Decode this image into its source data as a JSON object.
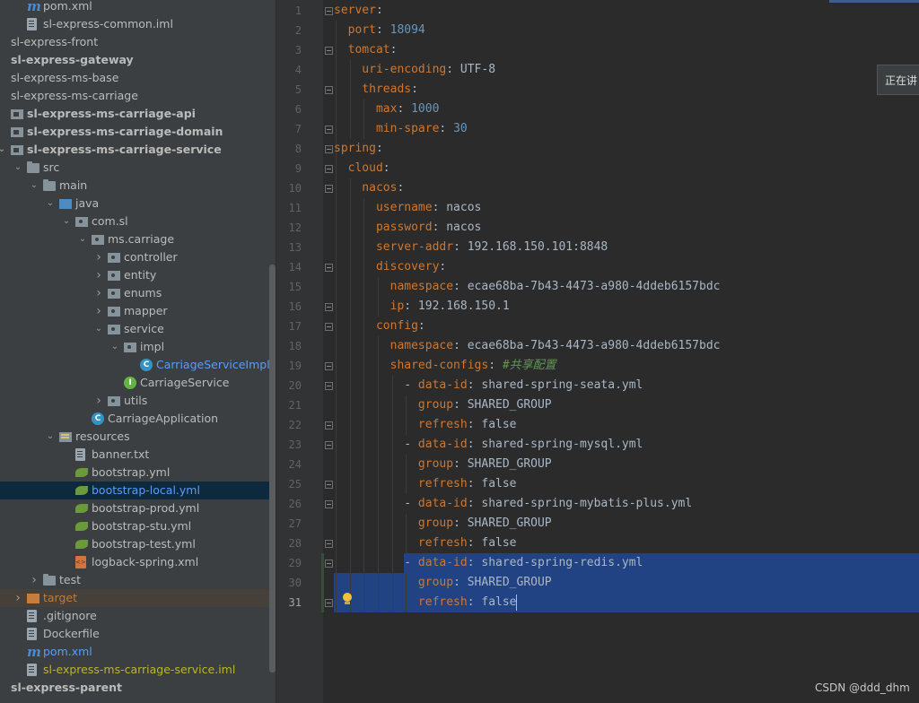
{
  "project_tree": {
    "rows": [
      {
        "label": "pom.xml",
        "icon": "maven-icon",
        "indent": 1
      },
      {
        "label": "sl-express-common.iml",
        "icon": "file-icon",
        "indent": 1
      },
      {
        "label": "sl-express-front",
        "icon": "none",
        "indent": 0
      },
      {
        "label": "sl-express-gateway",
        "icon": "none",
        "indent": 0,
        "bold": true
      },
      {
        "label": "sl-express-ms-base",
        "icon": "none",
        "indent": 0
      },
      {
        "label": "sl-express-ms-carriage",
        "icon": "none",
        "indent": 0
      },
      {
        "label": "sl-express-ms-carriage-api",
        "icon": "module-icon",
        "indent": 0,
        "bold": true
      },
      {
        "label": "sl-express-ms-carriage-domain",
        "icon": "module-icon",
        "indent": 0,
        "bold": true
      },
      {
        "label": "sl-express-ms-carriage-service",
        "icon": "module-icon",
        "indent": 0,
        "bold": true,
        "expanded": true
      },
      {
        "label": "src",
        "icon": "folder-icon",
        "indent": 1,
        "expanded": true
      },
      {
        "label": "main",
        "icon": "folder-icon",
        "indent": 2,
        "expanded": true
      },
      {
        "label": "java",
        "icon": "source-folder-icon",
        "indent": 3,
        "expanded": true
      },
      {
        "label": "com.sl",
        "icon": "package-icon",
        "indent": 4,
        "expanded": true
      },
      {
        "label": "ms.carriage",
        "icon": "package-icon",
        "indent": 5,
        "expanded": true
      },
      {
        "label": "controller",
        "icon": "package-icon",
        "indent": 6,
        "collapsed": true
      },
      {
        "label": "entity",
        "icon": "package-icon",
        "indent": 6,
        "collapsed": true
      },
      {
        "label": "enums",
        "icon": "package-icon",
        "indent": 6,
        "collapsed": true
      },
      {
        "label": "mapper",
        "icon": "package-icon",
        "indent": 6,
        "collapsed": true
      },
      {
        "label": "service",
        "icon": "package-icon",
        "indent": 6,
        "expanded": true
      },
      {
        "label": "impl",
        "icon": "package-icon",
        "indent": 7,
        "expanded": true
      },
      {
        "label": "CarriageServiceImpl",
        "icon": "class-icon",
        "indent": 8,
        "color": "blue"
      },
      {
        "label": "CarriageService",
        "icon": "interface-icon",
        "indent": 7
      },
      {
        "label": "utils",
        "icon": "package-icon",
        "indent": 6,
        "collapsed": true
      },
      {
        "label": "CarriageApplication",
        "icon": "spring-class-icon",
        "indent": 5
      },
      {
        "label": "resources",
        "icon": "resources-folder-icon",
        "indent": 3,
        "expanded": true
      },
      {
        "label": "banner.txt",
        "icon": "text-file-icon",
        "indent": 4
      },
      {
        "label": "bootstrap.yml",
        "icon": "yaml-icon",
        "indent": 4
      },
      {
        "label": "bootstrap-local.yml",
        "icon": "yaml-icon",
        "indent": 4,
        "selected": true,
        "color": "blue"
      },
      {
        "label": "bootstrap-prod.yml",
        "icon": "yaml-icon",
        "indent": 4
      },
      {
        "label": "bootstrap-stu.yml",
        "icon": "yaml-icon",
        "indent": 4
      },
      {
        "label": "bootstrap-test.yml",
        "icon": "yaml-icon",
        "indent": 4
      },
      {
        "label": "logback-spring.xml",
        "icon": "xml-icon",
        "indent": 4
      },
      {
        "label": "test",
        "icon": "folder-icon",
        "indent": 2,
        "collapsed": true
      },
      {
        "label": "target",
        "icon": "target-folder-icon",
        "indent": 1,
        "collapsed": true,
        "excluded": true,
        "color": "orange"
      },
      {
        "label": ".gitignore",
        "icon": "file-icon",
        "indent": 1
      },
      {
        "label": "Dockerfile",
        "icon": "file-icon",
        "indent": 1
      },
      {
        "label": "pom.xml",
        "icon": "maven-icon",
        "indent": 1,
        "color": "blue"
      },
      {
        "label": "sl-express-ms-carriage-service.iml",
        "icon": "file-icon",
        "indent": 1,
        "color": "yellow"
      },
      {
        "label": "sl-express-parent",
        "icon": "none",
        "indent": 0,
        "bold": true
      }
    ]
  },
  "editor": {
    "current_line": 31,
    "lines": [
      [
        {
          "t": "server",
          "c": "k"
        },
        {
          "t": ":",
          "c": "v"
        }
      ],
      [
        {
          "t": "  port",
          "c": "k"
        },
        {
          "t": ": ",
          "c": "v"
        },
        {
          "t": "18094",
          "c": "n"
        }
      ],
      [
        {
          "t": "  tomcat",
          "c": "k"
        },
        {
          "t": ":",
          "c": "v"
        }
      ],
      [
        {
          "t": "    uri-encoding",
          "c": "k"
        },
        {
          "t": ": UTF-8",
          "c": "v"
        }
      ],
      [
        {
          "t": "    threads",
          "c": "k"
        },
        {
          "t": ":",
          "c": "v"
        }
      ],
      [
        {
          "t": "      max",
          "c": "k"
        },
        {
          "t": ": ",
          "c": "v"
        },
        {
          "t": "1000",
          "c": "n"
        }
      ],
      [
        {
          "t": "      min-spare",
          "c": "k"
        },
        {
          "t": ": ",
          "c": "v"
        },
        {
          "t": "30",
          "c": "n"
        }
      ],
      [
        {
          "t": "spring",
          "c": "k"
        },
        {
          "t": ":",
          "c": "v"
        }
      ],
      [
        {
          "t": "  cloud",
          "c": "k"
        },
        {
          "t": ":",
          "c": "v"
        }
      ],
      [
        {
          "t": "    nacos",
          "c": "k"
        },
        {
          "t": ":",
          "c": "v"
        }
      ],
      [
        {
          "t": "      username",
          "c": "k"
        },
        {
          "t": ": nacos",
          "c": "v"
        }
      ],
      [
        {
          "t": "      password",
          "c": "k"
        },
        {
          "t": ": nacos",
          "c": "v"
        }
      ],
      [
        {
          "t": "      server-addr",
          "c": "k"
        },
        {
          "t": ": 192.168.150.101:8848",
          "c": "v"
        }
      ],
      [
        {
          "t": "      discovery",
          "c": "k"
        },
        {
          "t": ":",
          "c": "v"
        }
      ],
      [
        {
          "t": "        namespace",
          "c": "k"
        },
        {
          "t": ": ecae68ba-7b43-4473-a980-4ddeb6157bdc",
          "c": "v"
        }
      ],
      [
        {
          "t": "        ip",
          "c": "k"
        },
        {
          "t": ": 192.168.150.1",
          "c": "v"
        }
      ],
      [
        {
          "t": "      config",
          "c": "k"
        },
        {
          "t": ":",
          "c": "v"
        }
      ],
      [
        {
          "t": "        namespace",
          "c": "k"
        },
        {
          "t": ": ecae68ba-7b43-4473-a980-4ddeb6157bdc",
          "c": "v"
        }
      ],
      [
        {
          "t": "        shared-configs",
          "c": "k"
        },
        {
          "t": ": ",
          "c": "v"
        },
        {
          "t": "#共享配置",
          "c": "c"
        }
      ],
      [
        {
          "t": "          - ",
          "c": "v"
        },
        {
          "t": "data-id",
          "c": "k"
        },
        {
          "t": ": shared-spring-seata.yml",
          "c": "v"
        }
      ],
      [
        {
          "t": "            group",
          "c": "k"
        },
        {
          "t": ": SHARED_GROUP",
          "c": "v"
        }
      ],
      [
        {
          "t": "            refresh",
          "c": "k"
        },
        {
          "t": ": false",
          "c": "v"
        }
      ],
      [
        {
          "t": "          - ",
          "c": "v"
        },
        {
          "t": "data-id",
          "c": "k"
        },
        {
          "t": ": shared-spring-mysql.yml",
          "c": "v"
        }
      ],
      [
        {
          "t": "            group",
          "c": "k"
        },
        {
          "t": ": SHARED_GROUP",
          "c": "v"
        }
      ],
      [
        {
          "t": "            refresh",
          "c": "k"
        },
        {
          "t": ": false",
          "c": "v"
        }
      ],
      [
        {
          "t": "          - ",
          "c": "v"
        },
        {
          "t": "data-id",
          "c": "k"
        },
        {
          "t": ": shared-spring-mybatis-plus.yml",
          "c": "v"
        }
      ],
      [
        {
          "t": "            group",
          "c": "k"
        },
        {
          "t": ": SHARED_GROUP",
          "c": "v"
        }
      ],
      [
        {
          "t": "            refresh",
          "c": "k"
        },
        {
          "t": ": false",
          "c": "v"
        }
      ],
      [
        {
          "t": "          - ",
          "c": "v"
        },
        {
          "t": "data-id",
          "c": "k"
        },
        {
          "t": ": shared-spring-redis.yml",
          "c": "v"
        }
      ],
      [
        {
          "t": "            group",
          "c": "k"
        },
        {
          "t": ": SHARED_GROUP",
          "c": "v"
        }
      ],
      [
        {
          "t": "            refresh",
          "c": "k"
        },
        {
          "t": ": false",
          "c": "v"
        }
      ]
    ],
    "selected_lines": [
      29,
      30,
      31
    ],
    "fold_marker_lines": [
      1,
      3,
      5,
      7,
      8,
      9,
      10,
      14,
      16,
      17,
      19,
      20,
      22,
      23,
      25,
      26,
      28,
      29,
      31
    ]
  },
  "tooltip": {
    "text": "正在讲"
  },
  "watermark": {
    "text": "CSDN @ddd_dhm"
  },
  "colors": {
    "keyword": "#cc7832",
    "number": "#6897bb",
    "comment": "#629755",
    "text": "#a9b7c6",
    "selection": "#214283"
  }
}
